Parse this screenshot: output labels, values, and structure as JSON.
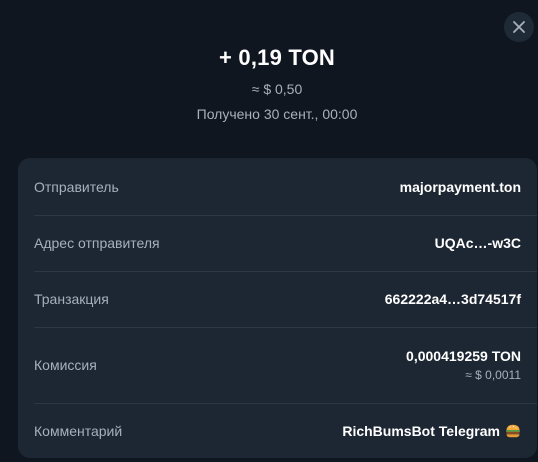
{
  "header": {
    "amount": "+ 0,19 TON",
    "fiat": "≈ $ 0,50",
    "received": "Получено 30 сент., 00:00"
  },
  "close_icon": "close-icon",
  "details": {
    "sender": {
      "label": "Отправитель",
      "value": "majorpayment.ton"
    },
    "sender_address": {
      "label": "Адрес отправителя",
      "value": "UQAc…-w3C"
    },
    "transaction": {
      "label": "Транзакция",
      "value": "662222a4…3d74517f"
    },
    "fee": {
      "label": "Комиссия",
      "value": "0,000419259 TON",
      "fiat": "≈ $ 0,0011"
    },
    "comment": {
      "label": "Комментарий",
      "value": "RichBumsBot Telegram",
      "emoji": "burger-emoji-icon"
    }
  },
  "colors": {
    "background": "#10161f",
    "card": "#1d2733",
    "divider": "#2b3744",
    "text_primary": "#ffffff",
    "text_secondary": "#a7b0bb"
  }
}
